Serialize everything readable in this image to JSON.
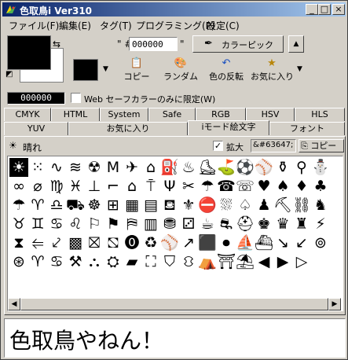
{
  "window": {
    "title": "色取鳥i Ver310"
  },
  "menu": [
    {
      "label": "ファイル(F)"
    },
    {
      "label": "編集(E)"
    },
    {
      "label": "タグ(T)"
    },
    {
      "label": "プログラミング(P)"
    },
    {
      "label": "設定(C)"
    }
  ],
  "colors": {
    "foreground": "#000000",
    "background": "#ffffff",
    "accent": "#0a246a"
  },
  "hex": {
    "prefix": "\" #",
    "value": "000000",
    "suffix": "\""
  },
  "picker": {
    "label": "カラーピック"
  },
  "actions": [
    {
      "label": "コピー",
      "icon": "copy-icon"
    },
    {
      "label": "ランダム",
      "icon": "palette-icon"
    },
    {
      "label": "色の反転",
      "icon": "undo-icon"
    },
    {
      "label": "お気に入り",
      "icon": "favorite-icon"
    }
  ],
  "current": {
    "hex": "000000"
  },
  "websafe": {
    "label": "Web セーフカラーのみに限定(W)",
    "checked": false
  },
  "tabs_row1": [
    {
      "label": "CMYK"
    },
    {
      "label": "HTML"
    },
    {
      "label": "System"
    },
    {
      "label": "Safe"
    },
    {
      "label": "RGB"
    },
    {
      "label": "HSV"
    },
    {
      "label": "HLS"
    }
  ],
  "tabs_row2": [
    {
      "label": "YUV"
    },
    {
      "label": "お気に入り"
    },
    {
      "label": "iモード絵文字"
    },
    {
      "label": "フォント"
    }
  ],
  "emoji_panel": {
    "selected_name": "晴れ",
    "zoom_label": "拡大",
    "zoom_checked": true,
    "code": "&#63647;",
    "copy_label": "コピー",
    "glyphs": [
      "☀",
      "⁙",
      "∿",
      "≋",
      "☢",
      "M",
      "✈",
      "⌂",
      "⛽",
      "♨",
      "⛸",
      "⛳",
      "⚽",
      "⚾",
      "⚱",
      "⚲",
      "⛄",
      "∞",
      "⌀",
      "♍",
      "♓",
      "⊥",
      "⌐",
      "⌂",
      "⍑",
      "Ψ",
      "✂",
      "☂",
      "☎",
      "☏",
      "♥",
      "♠",
      "♦",
      "♣",
      "☂",
      "♈",
      "♎",
      "⛟",
      "☸",
      "⊞",
      "▦",
      "▤",
      "⛾",
      "⚜",
      "⛔",
      "⛆",
      "♤",
      "♟",
      "⛏",
      "⛓",
      "♞",
      "♉",
      "♊",
      "♋",
      "♌",
      "⚐",
      "⚑",
      "⛿",
      "▥",
      "⛃",
      "⚂",
      "☕",
      "⛐",
      "⛑",
      "♚",
      "♛",
      "♜",
      "⚡",
      "⧗",
      "⥢",
      "⤦",
      "▩",
      "⛝",
      "⛞",
      "⓿",
      "♻",
      "⚾",
      "↗",
      "⬛",
      "⏺",
      "⛵",
      "⛴",
      "↘",
      "↙",
      "⊚",
      "⊛",
      "♈",
      "♋",
      "⚒",
      "⛬",
      "⛭",
      "▰",
      "⛶",
      "⛉",
      "⛻",
      "⛺",
      "⛩",
      "⛱",
      "◀",
      "▶",
      "▷"
    ]
  },
  "bottom_text": "色取鳥やねん！"
}
